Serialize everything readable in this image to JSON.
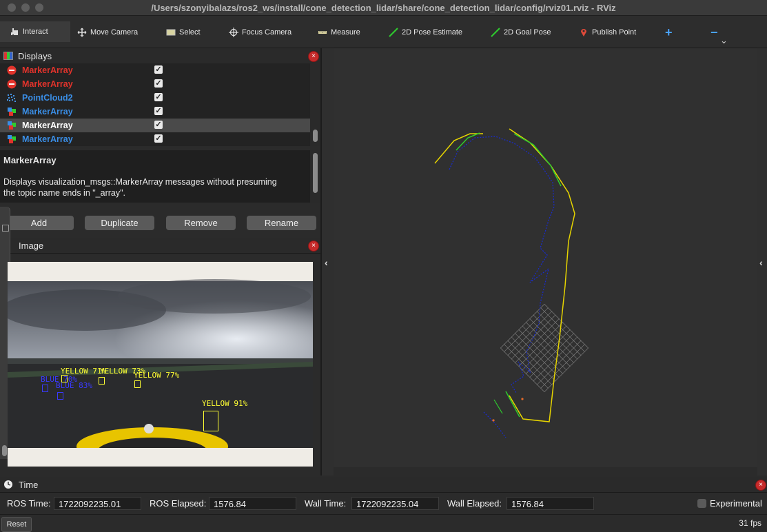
{
  "window": {
    "title": "/Users/szonyibalazs/ros2_ws/install/cone_detection_lidar/share/cone_detection_lidar/config/rviz01.rviz - RViz"
  },
  "toolbar": {
    "interact": "Interact",
    "move_camera": "Move Camera",
    "select": "Select",
    "focus_camera": "Focus Camera",
    "measure": "Measure",
    "pose_estimate": "2D Pose Estimate",
    "goal_pose": "2D Goal Pose",
    "publish_point": "Publish Point",
    "plus": "+",
    "minus": "−",
    "chevron": "⌄"
  },
  "displays": {
    "title": "Displays",
    "items": [
      {
        "label": "MarkerArray",
        "color": "#e2332b",
        "icon": "error-icon",
        "checked": "✓"
      },
      {
        "label": "MarkerArray",
        "color": "#e2332b",
        "icon": "error-icon",
        "checked": "✓"
      },
      {
        "label": "PointCloud2",
        "color": "#3a8ee6",
        "icon": "pointcloud-icon",
        "checked": "✓"
      },
      {
        "label": "MarkerArray",
        "color": "#3a8ee6",
        "icon": "marker-icon",
        "checked": "✓"
      },
      {
        "label": "MarkerArray",
        "color": "#ffffff",
        "icon": "marker-icon",
        "checked": "✓",
        "selected": true
      },
      {
        "label": "MarkerArray",
        "color": "#3a8ee6",
        "icon": "marker-icon",
        "checked": "✓"
      }
    ],
    "description_title": "MarkerArray",
    "description_line1": "Displays visualization_msgs::MarkerArray messages without presuming",
    "description_line2": "the topic name ends in \"_array\".",
    "buttons": {
      "add": "Add",
      "duplicate": "Duplicate",
      "remove": "Remove",
      "rename": "Rename"
    }
  },
  "image_panel": {
    "title": "Image",
    "detections": [
      {
        "label": "YELLOW 71%",
        "color": "#ffff33"
      },
      {
        "label": "YELLOW 73%",
        "color": "#ffff33"
      },
      {
        "label": "YELLOW 77%",
        "color": "#ffff33"
      },
      {
        "label": "YELLOW 91%",
        "color": "#ffff33"
      },
      {
        "label": "BLUE 70%",
        "color": "#3a3aff"
      },
      {
        "label": "BLUE 83%",
        "color": "#3a3aff"
      }
    ]
  },
  "time_panel": {
    "title": "Time",
    "ros_time_label": "ROS Time:",
    "ros_time": "1722092235.01",
    "ros_elapsed_label": "ROS Elapsed:",
    "ros_elapsed": "1576.84",
    "wall_time_label": "Wall Time:",
    "wall_time": "1722092235.04",
    "wall_elapsed_label": "Wall Elapsed:",
    "wall_elapsed": "1576.84",
    "experimental": "Experimental"
  },
  "status": {
    "reset": "Reset",
    "fps": "31 fps"
  },
  "colors": {
    "background": "#2b2b2b",
    "viewport": "#303030",
    "yellow_cones": "#e6d400",
    "blue_cones": "#1a2cc8",
    "green_path": "#2ecc2e"
  }
}
